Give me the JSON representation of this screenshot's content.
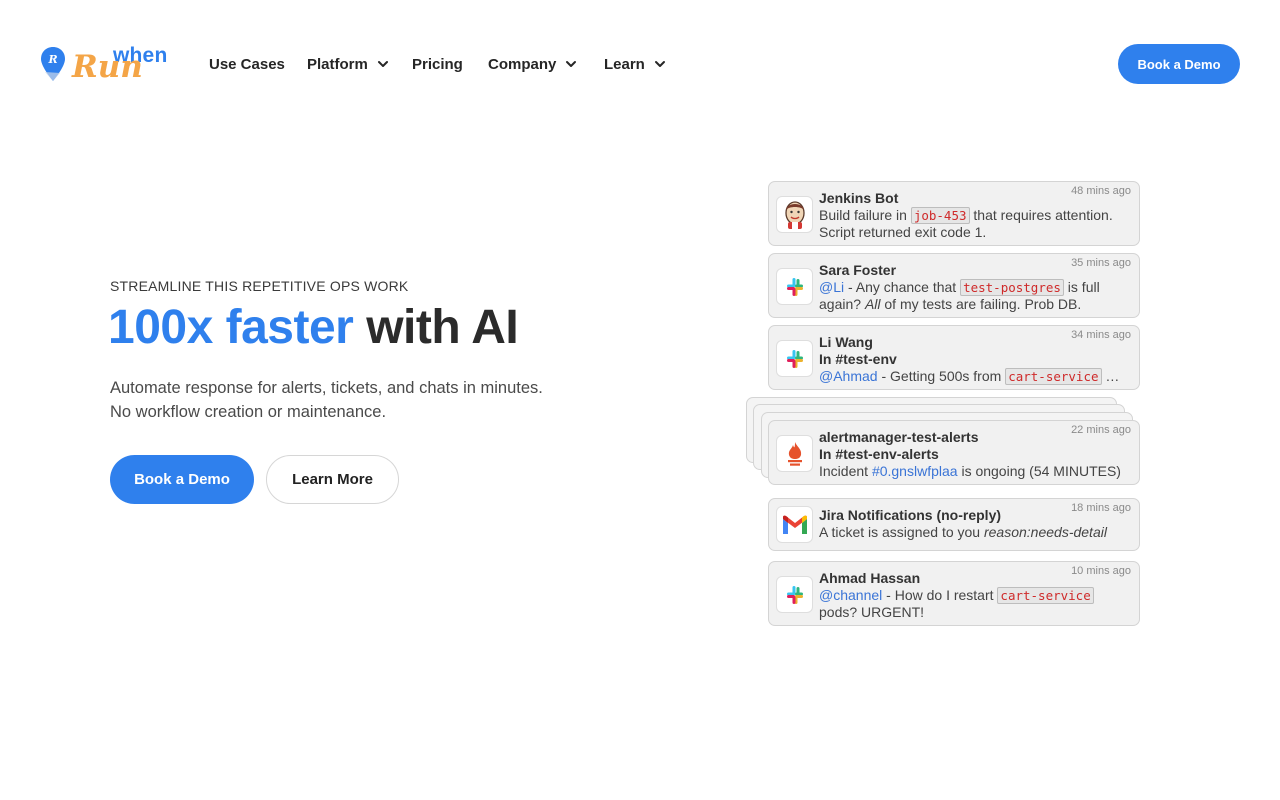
{
  "brand": {
    "logo_top": "when",
    "logo_main": "Run",
    "colors": {
      "primary": "#2f80ed",
      "accent_orange": "#f4a547",
      "text": "#2b2b2b"
    }
  },
  "nav": {
    "items": [
      {
        "label": "Use Cases",
        "has_dropdown": false
      },
      {
        "label": "Platform",
        "has_dropdown": true
      },
      {
        "label": "Pricing",
        "has_dropdown": false
      },
      {
        "label": "Company",
        "has_dropdown": true
      },
      {
        "label": "Learn",
        "has_dropdown": true
      }
    ],
    "cta": "Book a Demo"
  },
  "hero": {
    "eyebrow": "STREAMLINE THIS REPETITIVE OPS WORK",
    "headline_accent": "100x faster",
    "headline_rest": "with AI",
    "sub_line1": "Automate response for alerts, tickets, and chats in minutes.",
    "sub_line2": "No workflow creation or maintenance.",
    "primary_button": "Book a Demo",
    "secondary_button": "Learn More"
  },
  "notifications": [
    {
      "icon": "jenkins-icon",
      "sender": "Jenkins Bot",
      "time": "48 mins ago",
      "line1_pre": "Build failure in ",
      "line1_code": "job-453",
      "line1_post": " that requires attention.",
      "line2": "Script returned exit code 1."
    },
    {
      "icon": "slack-icon",
      "sender": "Sara Foster",
      "time": "35 mins ago",
      "line1_mention": "@Li",
      "line1_pre": " - Any chance that ",
      "line1_code": "test-postgres",
      "line1_post": " is full",
      "line2_pre": "again? ",
      "line2_em": "All",
      "line2_post": " of my tests are failing.  Prob DB."
    },
    {
      "icon": "slack-icon",
      "sender": "Li Wang",
      "time": "34 mins ago",
      "channel": "In #test-env",
      "line_mention": "@Ahmad",
      "line_pre": " - Getting 500s from ",
      "line_code": "cart-service",
      "line_post": " …"
    },
    {
      "icon": "prometheus-icon",
      "sender": "alertmanager-test-alerts",
      "time": "22 mins ago",
      "channel": "In #test-env-alerts",
      "line_pre": "Incident ",
      "line_link": "#0.gnslwfplaa",
      "line_post": " is ongoing (54 MINUTES)"
    },
    {
      "icon": "gmail-icon",
      "sender": "Jira Notifications (no-reply)",
      "time": "18 mins ago",
      "line_pre": "A ticket is assigned to you ",
      "line_em": "reason:needs-detail"
    },
    {
      "icon": "slack-icon",
      "sender": "Ahmad Hassan",
      "time": "10 mins ago",
      "line1_mention": "@channel",
      "line1_pre": " - How do I restart ",
      "line1_code": "cart-service",
      "line2": "pods?  URGENT!"
    }
  ]
}
